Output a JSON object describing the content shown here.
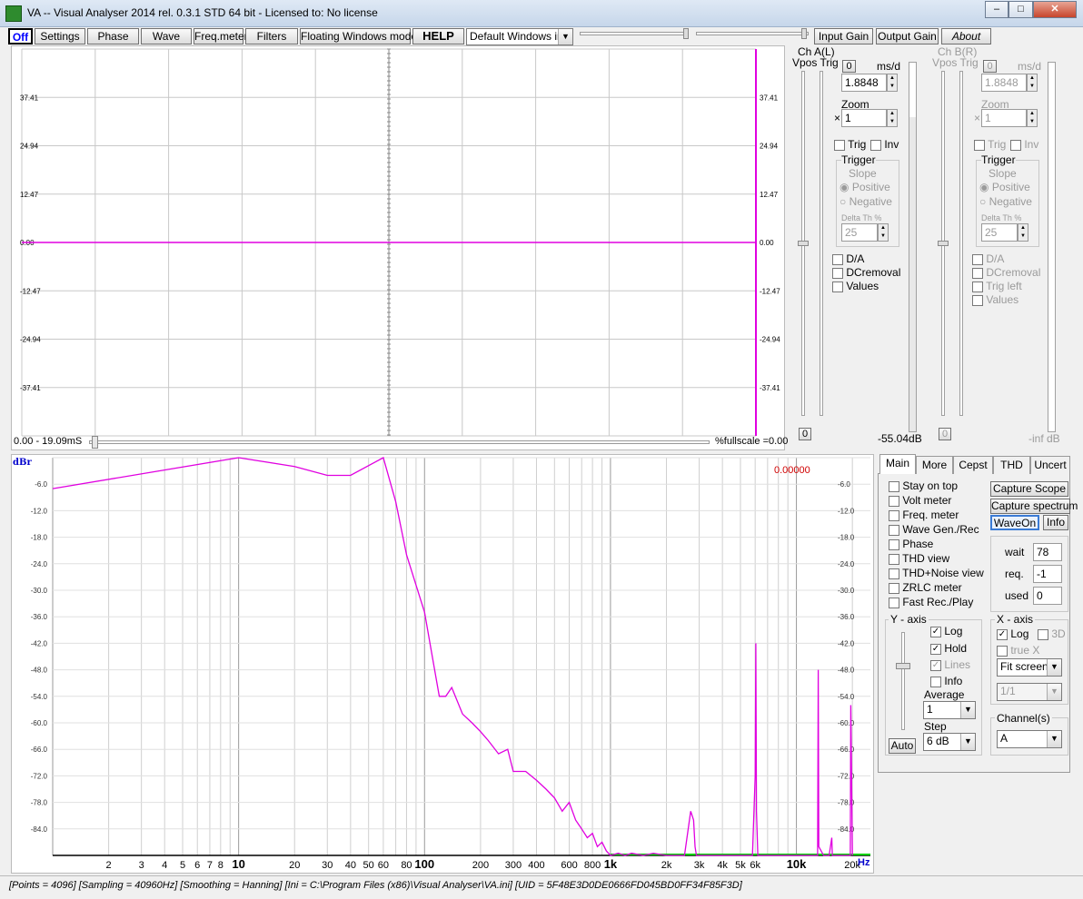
{
  "window": {
    "title": "VA -- Visual Analyser 2014 rel. 0.3.1 STD 64 bit - Licensed to: No license",
    "minimize": "–",
    "maximize": "□",
    "close": "✕"
  },
  "toolbar": {
    "off": "Off",
    "settings": "Settings",
    "phase": "Phase",
    "wave": "Wave",
    "freqmeter": "Freq.meter",
    "filters": "Filters",
    "floating": "Floating Windows mode",
    "help": "HELP",
    "windows_mode": "Default Windows inp",
    "input_gain": "Input Gain",
    "output_gain": "Output Gain",
    "about": "About"
  },
  "scope": {
    "y_ticks": [
      "37.41",
      "24.94",
      "12.47",
      "0.00",
      "-12.47",
      "-24.94",
      "-37.41"
    ],
    "time_label": "0.00 - 19.09mS",
    "fullscale_label": "%fullscale =0.00"
  },
  "chA": {
    "title": "Ch A(L)",
    "vpos_trig": "Vpos Trig",
    "zero_btn": "0",
    "msd_label": "ms/d",
    "msd_value": "1.8848",
    "zoom_label": "Zoom",
    "zoom_x": "×",
    "zoom_value": "1",
    "trig": "Trig",
    "inv": "Inv",
    "trigger": "Trigger",
    "slope": "Slope",
    "positive": "Positive",
    "negative": "Negative",
    "delta_th": "Delta Th %",
    "delta_value": "25",
    "da": "D/A",
    "dcremoval": "DCremoval",
    "values": "Values",
    "bottom_zero": "0",
    "level": "-55.04dB"
  },
  "chB": {
    "title": "Ch B(R)",
    "vpos_trig": "Vpos Trig",
    "zero_btn": "0",
    "msd_label": "ms/d",
    "msd_value": "1.8848",
    "zoom_label": "Zoom",
    "zoom_x": "×",
    "zoom_value": "1",
    "trig": "Trig",
    "inv": "Inv",
    "trigger": "Trigger",
    "slope": "Slope",
    "positive": "Positive",
    "negative": "Negative",
    "delta_th": "Delta Th %",
    "delta_value": "25",
    "da": "D/A",
    "dcremoval": "DCremoval",
    "trig_left": "Trig left",
    "values": "Values",
    "bottom_zero": "0",
    "level": "-inf dB"
  },
  "spectrum": {
    "unit_label": "dBr",
    "readout": "0.00000",
    "x_unit": "Hz",
    "db_ticks": [
      "-6.0",
      "-12.0",
      "-18.0",
      "-24.0",
      "-30.0",
      "-36.0",
      "-42.0",
      "-48.0",
      "-54.0",
      "-60.0",
      "-66.0",
      "-72.0",
      "-78.0",
      "-84.0"
    ],
    "freq_labels": [
      {
        "f": 2,
        "t": "2",
        "b": false
      },
      {
        "f": 3,
        "t": "3",
        "b": false
      },
      {
        "f": 4,
        "t": "4",
        "b": false
      },
      {
        "f": 5,
        "t": "5",
        "b": false
      },
      {
        "f": 6,
        "t": "6",
        "b": false
      },
      {
        "f": 7,
        "t": "7",
        "b": false
      },
      {
        "f": 8,
        "t": "8",
        "b": false
      },
      {
        "f": 10,
        "t": "10",
        "b": true
      },
      {
        "f": 20,
        "t": "20",
        "b": false
      },
      {
        "f": 30,
        "t": "30",
        "b": false
      },
      {
        "f": 40,
        "t": "40",
        "b": false
      },
      {
        "f": 50,
        "t": "50",
        "b": false
      },
      {
        "f": 60,
        "t": "60",
        "b": false
      },
      {
        "f": 80,
        "t": "80",
        "b": false
      },
      {
        "f": 100,
        "t": "100",
        "b": true
      },
      {
        "f": 200,
        "t": "200",
        "b": false
      },
      {
        "f": 300,
        "t": "300",
        "b": false
      },
      {
        "f": 400,
        "t": "400",
        "b": false
      },
      {
        "f": 600,
        "t": "600",
        "b": false
      },
      {
        "f": 800,
        "t": "800",
        "b": false
      },
      {
        "f": 1000,
        "t": "1k",
        "b": true
      },
      {
        "f": 2000,
        "t": "2k",
        "b": false
      },
      {
        "f": 3000,
        "t": "3k",
        "b": false
      },
      {
        "f": 4000,
        "t": "4k",
        "b": false
      },
      {
        "f": 5000,
        "t": "5k",
        "b": false
      },
      {
        "f": 6000,
        "t": "6k",
        "b": false
      },
      {
        "f": 10000,
        "t": "10k",
        "b": true
      },
      {
        "f": 20000,
        "t": "20k",
        "b": false
      }
    ]
  },
  "tabs": [
    "Main",
    "More",
    "Cepst",
    "THD",
    "Uncert"
  ],
  "main": {
    "checks": [
      "Stay on top",
      "Volt meter",
      "Freq. meter",
      "Wave Gen./Rec",
      "Phase",
      "THD view",
      "THD+Noise view",
      "ZRLC meter",
      "Fast Rec./Play"
    ],
    "capture_scope": "Capture Scope",
    "capture_spectrum": "Capture spectrum",
    "wave_on": "WaveOn",
    "info": "Info",
    "wait_label": "wait",
    "wait_value": "78",
    "req_label": "req.",
    "req_value": "-1",
    "used_label": "used",
    "used_value": "0",
    "y_axis": "Y - axis",
    "y_log": "Log",
    "y_hold": "Hold",
    "y_lines": "Lines",
    "y_info": "Info",
    "average_label": "Average",
    "average_value": "1",
    "step_label": "Step",
    "step_value": "6 dB",
    "auto": "Auto",
    "x_axis": "X - axis",
    "x_log": "Log",
    "x_3d": "3D",
    "x_truex": "true X",
    "fit": "Fit screen",
    "ratio": "1/1",
    "channels_label": "Channel(s)",
    "channel_value": "A"
  },
  "status": "[Points = 4096]  [Sampling = 40960Hz]  [Smoothing = Hanning]  [Ini = C:\\Program Files (x86)\\Visual Analyser\\VA.ini]  [UID = 5F48E3D0DE0666FD045BD0FF34F85F3D]",
  "chart_data": {
    "type": "line",
    "x_scale": "log",
    "xlim": [
      1,
      25000
    ],
    "ylim": [
      -90,
      0
    ],
    "series": [
      {
        "color": "#e000e0",
        "x": [
          1,
          10,
          20,
          30,
          40,
          60,
          70,
          80,
          100,
          110,
          120,
          130,
          140,
          160,
          180,
          200,
          220,
          250,
          280,
          300,
          350,
          400,
          450,
          500,
          550,
          600,
          650,
          700,
          750,
          800,
          850,
          900,
          950,
          1000,
          1100,
          1200,
          1300,
          1500,
          1700,
          2000,
          2500,
          2700,
          2800,
          2850,
          2900,
          3000,
          3500,
          4000,
          5000,
          5800,
          6000,
          6050,
          6100,
          6200,
          6500,
          8000,
          10000,
          12000,
          13000,
          13100,
          13200,
          14000,
          15000,
          15500,
          15600,
          16000,
          18000,
          19500,
          19600,
          20000
        ],
        "y": [
          -7,
          0,
          -2,
          -4,
          -4,
          0,
          -10,
          -22,
          -35,
          -45,
          -54,
          -54,
          -52,
          -58,
          -60,
          -62,
          -64,
          -67,
          -66,
          -71,
          -71,
          -73,
          -75,
          -77,
          -80,
          -78,
          -82,
          -84,
          -86,
          -85,
          -88,
          -87,
          -89,
          -90,
          -89.5,
          -90,
          -89.5,
          -90,
          -89.5,
          -90,
          -90,
          -80,
          -82,
          -88,
          -90,
          -90,
          -90,
          -90,
          -90,
          -90,
          -72,
          -42,
          -80,
          -90,
          -90,
          -90,
          -90,
          -90,
          -90,
          -48,
          -88,
          -90,
          -90,
          -86,
          -90,
          -90,
          -90,
          -90,
          -56,
          -90
        ]
      }
    ]
  }
}
